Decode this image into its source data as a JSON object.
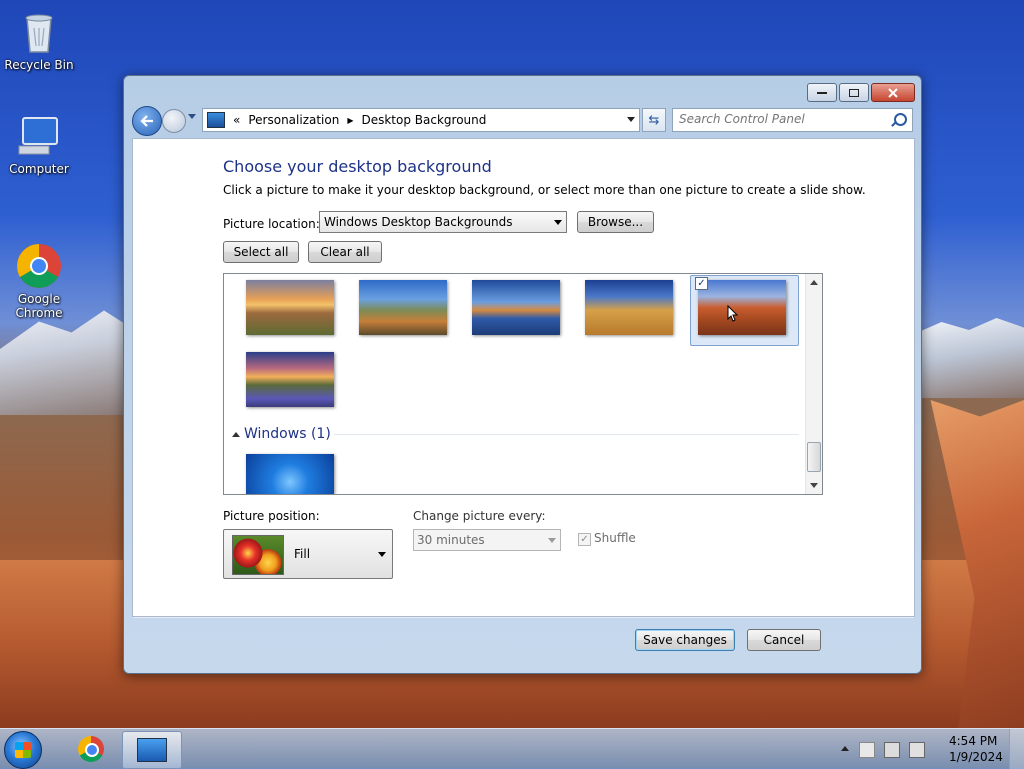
{
  "desktop": {
    "icons": [
      {
        "label": "Recycle Bin"
      },
      {
        "label": "Computer"
      },
      {
        "label": "Google\nChrome"
      }
    ]
  },
  "window": {
    "address": {
      "chevron": "«",
      "crumbs": [
        "Personalization",
        "Desktop Background"
      ]
    },
    "search": {
      "placeholder": "Search Control Panel"
    },
    "title": "Choose your desktop background",
    "description": "Click a picture to make it your desktop background, or select more than one picture to create a slide show.",
    "picture_location": {
      "label": "Picture location:",
      "value": "Windows Desktop Backgrounds"
    },
    "browse_label": "Browse...",
    "select_all_label": "Select all",
    "clear_all_label": "Clear all",
    "gallery": {
      "group_header": "Windows (1)",
      "selected_check": "✓"
    },
    "picture_position": {
      "label": "Picture position:",
      "value": "Fill"
    },
    "change_picture": {
      "label": "Change picture every:",
      "value": "30 minutes"
    },
    "shuffle": {
      "label": "Shuffle",
      "check": "✓"
    },
    "save_label": "Save changes",
    "cancel_label": "Cancel"
  },
  "taskbar": {
    "clock_time": "4:54 PM",
    "clock_date": "1/9/2024"
  }
}
